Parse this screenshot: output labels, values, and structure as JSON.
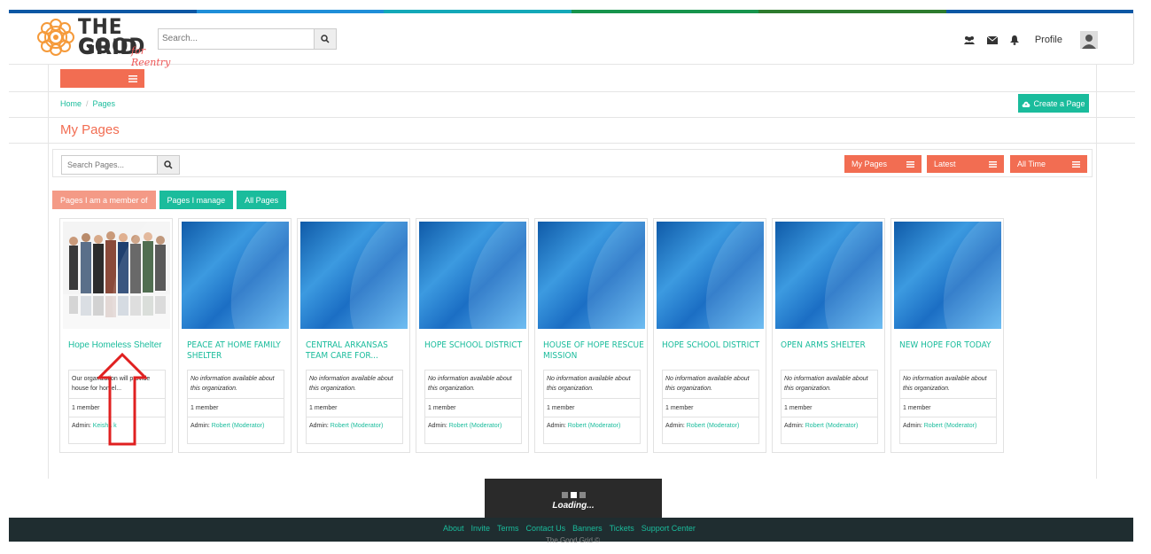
{
  "colors": {
    "accent": "#f26d52",
    "teal": "#1abc9c",
    "light_coral": "#f49a86",
    "footer_bg": "#1f2d30",
    "stripe": [
      "#0b57a4",
      "#1f8ed8",
      "#13a8b8",
      "#17944c",
      "#2d7b2e",
      "#0b57a4"
    ]
  },
  "header": {
    "logo": {
      "line1": "THE GOOD",
      "line2": "GRID",
      "tagline": "for Reentry"
    },
    "search_placeholder": "Search...",
    "profile_label": "Profile",
    "icons": [
      "users-icon",
      "envelope-icon",
      "bell-icon",
      "avatar-icon"
    ]
  },
  "breadcrumb": {
    "home": "Home",
    "current": "Pages"
  },
  "create_page_label": "Create a Page",
  "page_title": "My Pages",
  "filters": {
    "search_placeholder": "Search Pages...",
    "my_pages": "My Pages",
    "latest": "Latest",
    "all_time": "All Time"
  },
  "tabs": {
    "member": "Pages I am a member of",
    "manage": "Pages I manage",
    "all": "All Pages"
  },
  "cards": [
    {
      "name": "Hope Homeless Shelter",
      "desc": "Our organization will provide house for homel...",
      "members": "1 member",
      "admin_label": "Admin:",
      "admin": "Keisha k"
    },
    {
      "name": "PEACE AT HOME FAMILY SHELTER",
      "desc": "No information available about this organization.",
      "members": "1 member",
      "admin_label": "Admin:",
      "admin": "Robert (Moderator)"
    },
    {
      "name": "CENTRAL ARKANSAS TEAM CARE FOR...",
      "desc": "No information available about this organization.",
      "members": "1 member",
      "admin_label": "Admin:",
      "admin": "Robert (Moderator)"
    },
    {
      "name": "HOPE SCHOOL DISTRICT",
      "desc": "No information available about this organization.",
      "members": "1 member",
      "admin_label": "Admin:",
      "admin": "Robert (Moderator)"
    },
    {
      "name": "HOUSE OF HOPE RESCUE MISSION",
      "desc": "No information available about this organization.",
      "members": "1 member",
      "admin_label": "Admin:",
      "admin": "Robert (Moderator)"
    },
    {
      "name": "HOPE SCHOOL DISTRICT",
      "desc": "No information available about this organization.",
      "members": "1 member",
      "admin_label": "Admin:",
      "admin": "Robert (Moderator)"
    },
    {
      "name": "OPEN ARMS SHELTER",
      "desc": "No information available about this organization.",
      "members": "1 member",
      "admin_label": "Admin:",
      "admin": "Robert (Moderator)"
    },
    {
      "name": "NEW HOPE FOR TODAY",
      "desc": "No information available about this organization.",
      "members": "1 member",
      "admin_label": "Admin:",
      "admin": "Robert (Moderator)"
    }
  ],
  "loading_text": "Loading...",
  "footer": {
    "links": [
      "About",
      "Invite",
      "Terms",
      "Contact Us",
      "Banners",
      "Tickets",
      "Support Center"
    ],
    "copyright": "The Good Grid ©"
  }
}
